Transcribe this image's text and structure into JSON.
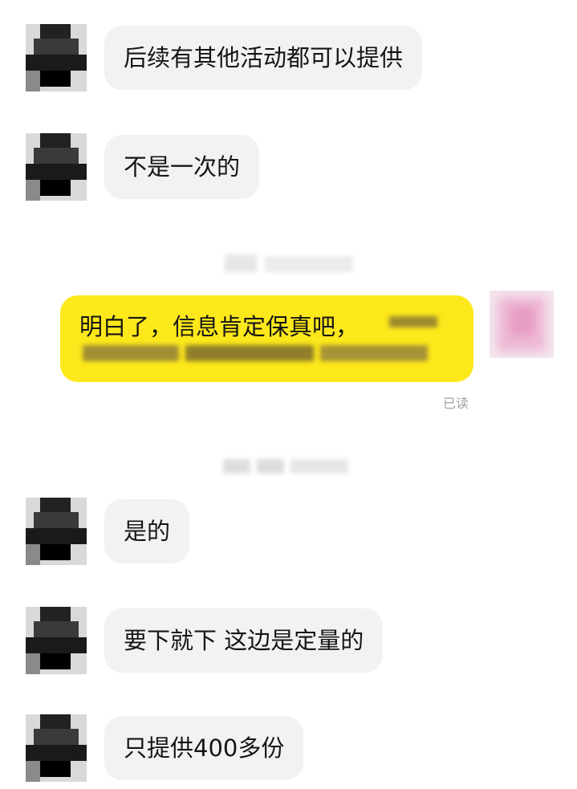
{
  "messages": [
    {
      "sender": "other",
      "text": "后续有其他活动都可以提供"
    },
    {
      "sender": "other",
      "text": "不是一次的"
    },
    {
      "sender": "me",
      "text": "明白了，信息肯定保真吧，"
    },
    {
      "sender": "other",
      "text": "是的"
    },
    {
      "sender": "other",
      "text": "要下就下 这边是定量的"
    },
    {
      "sender": "other",
      "text": "只提供400多份"
    }
  ],
  "read_receipt": "已读",
  "colors": {
    "incoming_bubble": "#f2f2f3",
    "outgoing_bubble": "#fde81b",
    "background": "#ffffff",
    "read_receipt": "#a3a3a3"
  }
}
